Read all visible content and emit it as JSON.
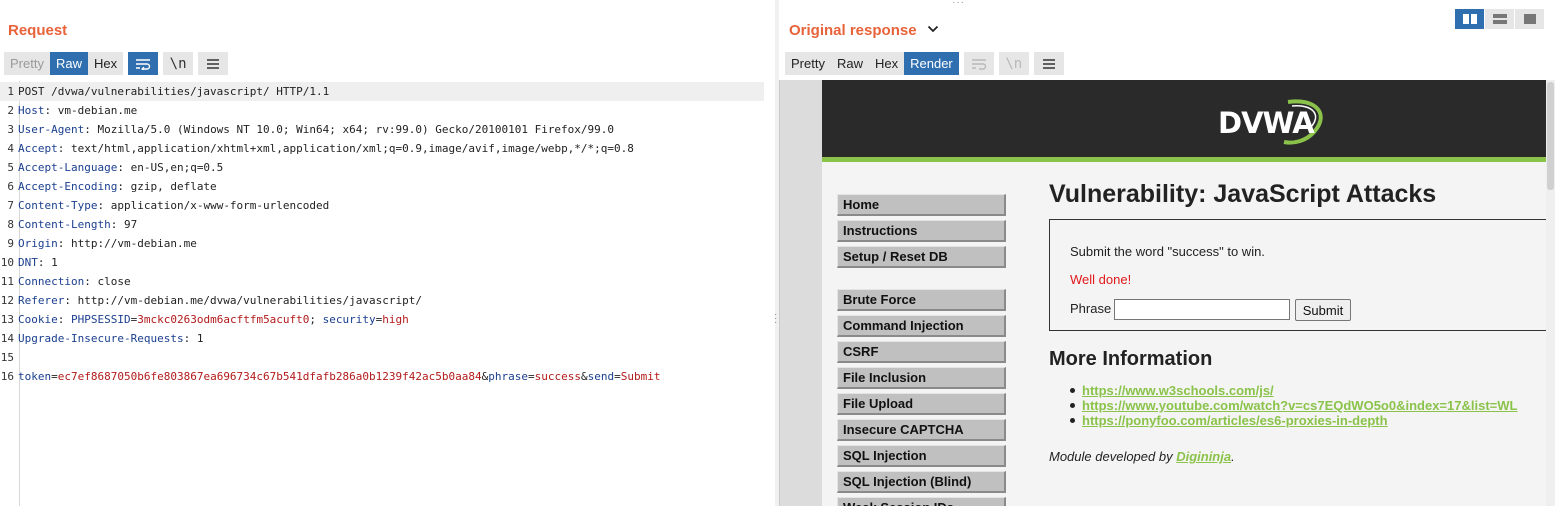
{
  "request": {
    "title": "Request",
    "tabs": [
      "Pretty",
      "Raw",
      "Hex"
    ],
    "active_tab": "Raw",
    "icons": [
      "wrap-lines-icon",
      "newline-icon",
      "menu-icon"
    ],
    "newline_label": "\\n",
    "lines": [
      {
        "n": "1",
        "parts": [
          {
            "t": "POST /dvwa/vulnerabilities/javascript/ HTTP/1.1",
            "c": "hv"
          }
        ]
      },
      {
        "n": "2",
        "parts": [
          {
            "t": "Host",
            "c": "hk"
          },
          {
            "t": ": vm-debian.me",
            "c": "hv"
          }
        ]
      },
      {
        "n": "3",
        "parts": [
          {
            "t": "User-Agent",
            "c": "hk"
          },
          {
            "t": ": Mozilla/5.0 (Windows NT 10.0; Win64; x64; rv:99.0) Gecko/20100101 Firefox/99.0",
            "c": "hv"
          }
        ]
      },
      {
        "n": "4",
        "parts": [
          {
            "t": "Accept",
            "c": "hk"
          },
          {
            "t": ": text/html,application/xhtml+xml,application/xml;q=0.9,image/avif,image/webp,*/*;q=0.8",
            "c": "hv"
          }
        ]
      },
      {
        "n": "5",
        "parts": [
          {
            "t": "Accept-Language",
            "c": "hk"
          },
          {
            "t": ": en-US,en;q=0.5",
            "c": "hv"
          }
        ]
      },
      {
        "n": "6",
        "parts": [
          {
            "t": "Accept-Encoding",
            "c": "hk"
          },
          {
            "t": ": gzip, deflate",
            "c": "hv"
          }
        ]
      },
      {
        "n": "7",
        "parts": [
          {
            "t": "Content-Type",
            "c": "hk"
          },
          {
            "t": ": application/x-www-form-urlencoded",
            "c": "hv"
          }
        ]
      },
      {
        "n": "8",
        "parts": [
          {
            "t": "Content-Length",
            "c": "hk"
          },
          {
            "t": ": 97",
            "c": "hv"
          }
        ]
      },
      {
        "n": "9",
        "parts": [
          {
            "t": "Origin",
            "c": "hk"
          },
          {
            "t": ": http://vm-debian.me",
            "c": "hv"
          }
        ]
      },
      {
        "n": "10",
        "parts": [
          {
            "t": "DNT",
            "c": "hk"
          },
          {
            "t": ": 1",
            "c": "hv"
          }
        ]
      },
      {
        "n": "11",
        "parts": [
          {
            "t": "Connection",
            "c": "hk"
          },
          {
            "t": ": close",
            "c": "hv"
          }
        ]
      },
      {
        "n": "12",
        "parts": [
          {
            "t": "Referer",
            "c": "hk"
          },
          {
            "t": ": http://vm-debian.me/dvwa/vulnerabilities/javascript/",
            "c": "hv"
          }
        ]
      },
      {
        "n": "13",
        "parts": [
          {
            "t": "Cookie",
            "c": "hk"
          },
          {
            "t": ": ",
            "c": "hv"
          },
          {
            "t": "PHPSESSID",
            "c": "pk"
          },
          {
            "t": "=",
            "c": "hv"
          },
          {
            "t": "3mckc0263odm6acftfm5acuft0",
            "c": "pv"
          },
          {
            "t": "; ",
            "c": "hv"
          },
          {
            "t": "security",
            "c": "pk"
          },
          {
            "t": "=",
            "c": "hv"
          },
          {
            "t": "high",
            "c": "pv"
          }
        ]
      },
      {
        "n": "14",
        "parts": [
          {
            "t": "Upgrade-Insecure-Requests",
            "c": "hk"
          },
          {
            "t": ": 1",
            "c": "hv"
          }
        ]
      },
      {
        "n": "15",
        "parts": []
      },
      {
        "n": "16",
        "parts": [
          {
            "t": "token",
            "c": "pk"
          },
          {
            "t": "=",
            "c": "hv"
          },
          {
            "t": "ec7ef8687050b6fe803867ea696734c67b541dfafb286a0b1239f42ac5b0aa84",
            "c": "pv"
          },
          {
            "t": "&",
            "c": "hv"
          },
          {
            "t": "phrase",
            "c": "pk"
          },
          {
            "t": "=",
            "c": "hv"
          },
          {
            "t": "success",
            "c": "pv"
          },
          {
            "t": "&",
            "c": "hv"
          },
          {
            "t": "send",
            "c": "pk"
          },
          {
            "t": "=",
            "c": "hv"
          },
          {
            "t": "Submit",
            "c": "pv"
          }
        ]
      }
    ]
  },
  "response": {
    "title": "Original response",
    "tabs": [
      "Pretty",
      "Raw",
      "Hex",
      "Render"
    ],
    "active_tab": "Render",
    "newline_label": "\\n"
  },
  "layout_toggle": [
    "split-horizontal-icon",
    "split-vertical-icon",
    "single-pane-icon"
  ],
  "dvwa": {
    "logo": "DVWA",
    "menu_top": [
      "Home",
      "Instructions",
      "Setup / Reset DB"
    ],
    "menu_vulns": [
      "Brute Force",
      "Command Injection",
      "CSRF",
      "File Inclusion",
      "File Upload",
      "Insecure CAPTCHA",
      "SQL Injection",
      "SQL Injection (Blind)",
      "Weak Session IDs"
    ],
    "heading": "Vulnerability: JavaScript Attacks",
    "instruction": "Submit the word \"success\" to win.",
    "result": "Well done!",
    "phrase_label": "Phrase",
    "phrase_value": "",
    "submit_label": "Submit",
    "more_info_heading": "More Information",
    "links": [
      "https://www.w3schools.com/js/",
      "https://www.youtube.com/watch?v=cs7EQdWO5o0&index=17&list=WL",
      "https://ponyfoo.com/articles/es6-proxies-in-depth"
    ],
    "credit_prefix": "Module developed by ",
    "credit_author": "Digininja",
    "credit_suffix": "."
  },
  "colors": {
    "accent": "#e8623a",
    "active_tab": "#2f6fb0",
    "header_key": "#1b3f8f",
    "param_value": "#b21a1a",
    "dvwa_green": "#8bc34a",
    "success_red": "#e0191b"
  }
}
